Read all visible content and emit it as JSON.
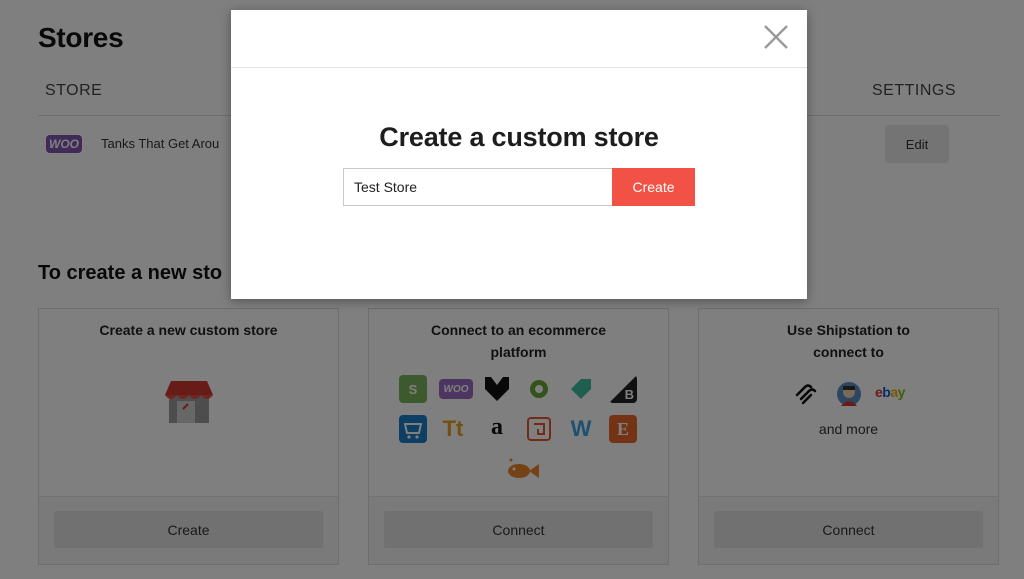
{
  "page": {
    "title": "Stores",
    "table": {
      "columns": {
        "store": "STORE",
        "settings": "SETTINGS"
      },
      "rows": [
        {
          "platform_badge": "WOO",
          "name": "Tanks That Get Arou",
          "edit_label": "Edit"
        }
      ]
    },
    "section_title": "To create a new sto",
    "cards": [
      {
        "title": "Create a new custom store",
        "button_label": "Create"
      },
      {
        "title": "Connect to an ecommerce platform",
        "button_label": "Connect"
      },
      {
        "title": "Use Shipstation to connect to",
        "and_more": "and more",
        "button_label": "Connect"
      }
    ],
    "platform_logos": {
      "woo": "WOO",
      "bigcommerce": "B",
      "tt": "Tt",
      "amazon": "a",
      "weebly": "W",
      "etsy": "E",
      "ebay": "ebay"
    }
  },
  "modal": {
    "title": "Create a custom store",
    "input_value": "Test Store",
    "create_label": "Create"
  },
  "colors": {
    "accent": "#f15245",
    "woo_purple": "#7f54b3",
    "overlay": "rgba(0,0,0,0.5)"
  },
  "icons": [
    "close-icon",
    "shop-icon",
    "shopify-icon",
    "woocommerce-icon",
    "bigcartel-icon",
    "opencart-icon",
    "tag-icon",
    "bigcommerce-icon",
    "cart-icon",
    "tt-icon",
    "amazon-icon",
    "spiral-icon",
    "weebly-icon",
    "etsy-icon",
    "fish-icon",
    "squarespace-icon",
    "shipstation-icon",
    "ebay-icon"
  ]
}
